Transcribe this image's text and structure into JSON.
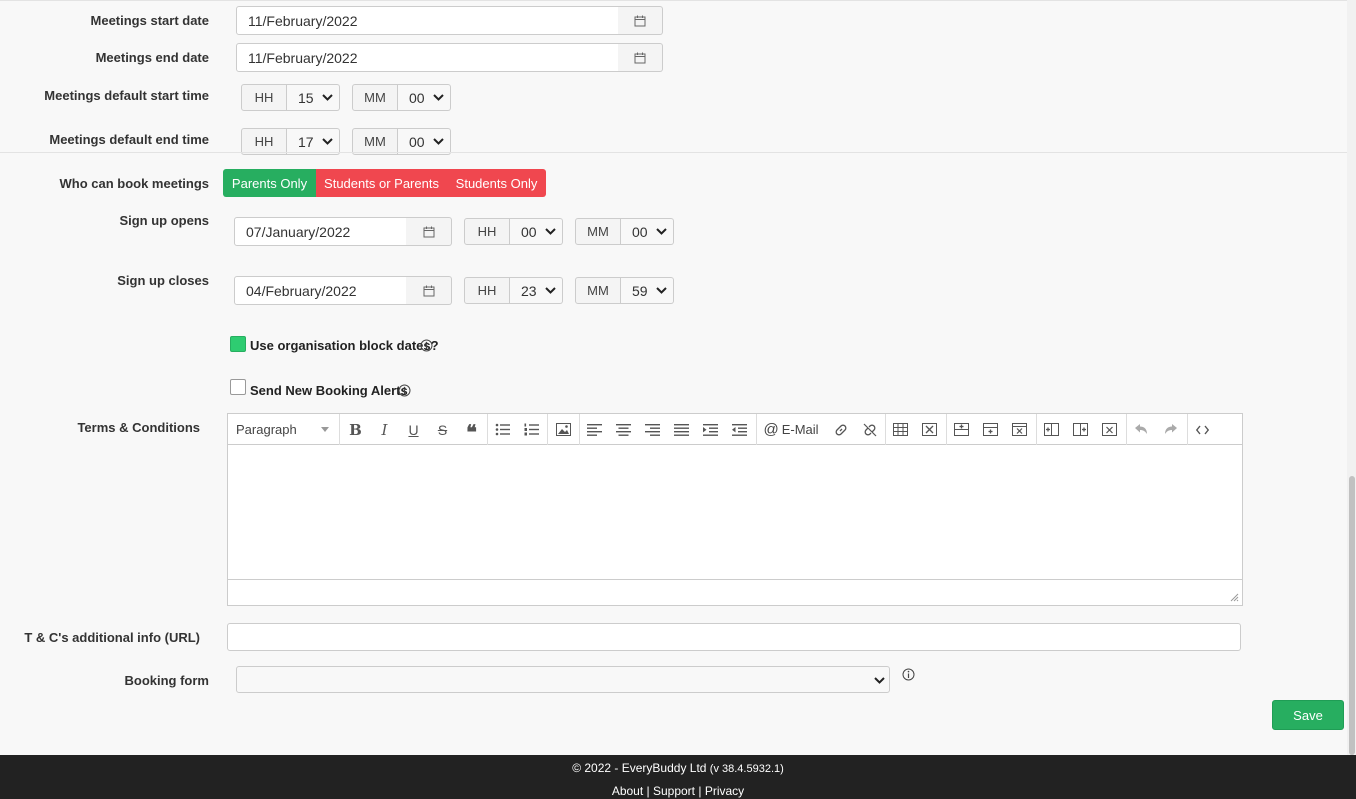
{
  "meetings": {
    "start_date_label": "Meetings start date",
    "start_date_value": "11/February/2022",
    "end_date_label": "Meetings end date",
    "end_date_value": "11/February/2022",
    "default_start_label": "Meetings default start time",
    "default_start_hh": "15",
    "default_start_mm": "00",
    "default_end_label": "Meetings default end time",
    "default_end_hh": "17",
    "default_end_mm": "00"
  },
  "time_addons": {
    "hh": "HH",
    "mm": "MM"
  },
  "booking": {
    "who_label": "Who can book meetings",
    "options": [
      "Parents Only",
      "Students or Parents",
      "Students Only"
    ],
    "selected": "Parents Only"
  },
  "signup": {
    "opens_label": "Sign up opens",
    "opens_date": "07/January/2022",
    "opens_hh": "00",
    "opens_mm": "00",
    "closes_label": "Sign up closes",
    "closes_date": "04/February/2022",
    "closes_hh": "23",
    "closes_mm": "59"
  },
  "checkboxes": {
    "block_dates_label": "Use organisation block dates?",
    "block_dates_checked": true,
    "alerts_label": "Send New Booking Alerts",
    "alerts_checked": false
  },
  "terms": {
    "label": "Terms & Conditions",
    "format_select": "Paragraph",
    "email_button": "E-Mail",
    "content": ""
  },
  "tc_url": {
    "label": "T & C's additional info (URL)",
    "value": ""
  },
  "booking_form": {
    "label": "Booking form",
    "value": ""
  },
  "save_label": "Save",
  "footer": {
    "copyright": "© 2022 - EveryBuddy Ltd",
    "version": "(v 38.4.5932.1)",
    "links": [
      "About",
      "Support",
      "Privacy"
    ],
    "separator": "|"
  },
  "colors": {
    "green": "#27ae60",
    "red": "#f0474f",
    "footer_bg": "#222222"
  }
}
